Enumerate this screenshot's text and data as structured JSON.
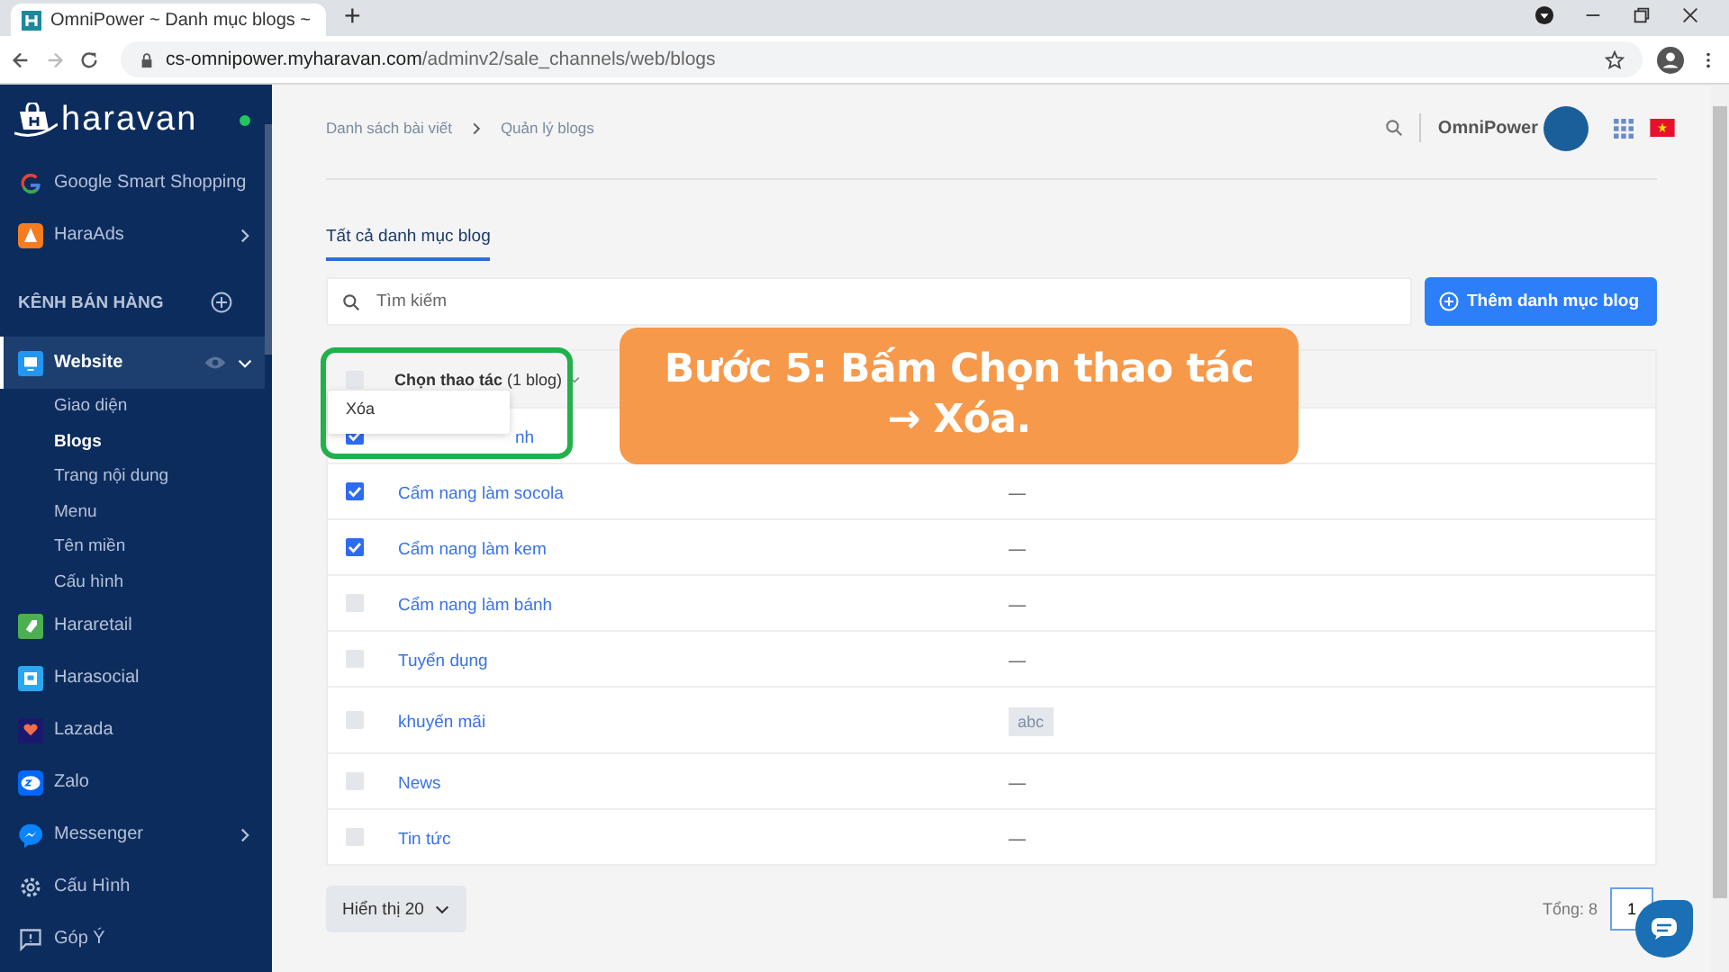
{
  "browser": {
    "tab_title": "OmniPower ~ Danh mục blogs ~",
    "new_tab": "+",
    "url_domain": "cs-omnipower.myharavan.com",
    "url_path": "/adminv2/sale_channels/web/blogs"
  },
  "sidebar": {
    "logo": "haravan",
    "online": true,
    "items": [
      {
        "kind": "google",
        "label": "Google Smart Shopping",
        "selected": false
      },
      {
        "kind": "haraads",
        "label": "HaraAds",
        "expanded": false,
        "selected": false
      },
      {
        "kind": "section",
        "label": "KÊNH BÁN HÀNG"
      },
      {
        "kind": "website",
        "label": "Website",
        "expanded": true,
        "eye": true,
        "selected": true
      },
      {
        "kind": "sub",
        "label": "Giao diện",
        "selected": false
      },
      {
        "kind": "sub",
        "label": "Blogs",
        "selected": true
      },
      {
        "kind": "sub",
        "label": "Trang nội dung",
        "selected": false
      },
      {
        "kind": "sub",
        "label": "Menu",
        "selected": false
      },
      {
        "kind": "sub",
        "label": "Tên miền",
        "selected": false
      },
      {
        "kind": "sub",
        "label": "Cấu hình",
        "selected": false
      },
      {
        "kind": "hararetail",
        "label": "Hararetail",
        "selected": false
      },
      {
        "kind": "harasocial",
        "label": "Harasocial",
        "selected": false
      },
      {
        "kind": "lazada",
        "label": "Lazada",
        "selected": false
      },
      {
        "kind": "zalo",
        "label": "Zalo",
        "selected": false
      },
      {
        "kind": "messenger",
        "label": "Messenger",
        "expanded": false,
        "selected": false
      }
    ],
    "footer": [
      {
        "kind": "gear",
        "label": "Cấu Hình"
      },
      {
        "kind": "feedback",
        "label": "Góp Ý"
      }
    ]
  },
  "breadcrumbs": [
    "Danh sách bài viết",
    "Quản lý blogs"
  ],
  "header": {
    "shop_name": "OmniPower"
  },
  "tabs": [
    {
      "label": "Tất cả danh mục blog",
      "selected": true
    }
  ],
  "search": {
    "placeholder": "Tìm kiếm"
  },
  "add_button": "Thêm danh mục blog",
  "table": {
    "header_checked": false,
    "bulk_label": "**Chọn thao tác** (1 blog)",
    "rows": [
      {
        "title": "nh",
        "checked": true,
        "column_2": {
          "kind": "none"
        }
      },
      {
        "title": "Cẩm nang làm socola",
        "checked": true,
        "column_2": {
          "kind": "text",
          "text": "—"
        }
      },
      {
        "title": "Cẩm nang làm kem",
        "checked": true,
        "column_2": {
          "kind": "text",
          "text": "—"
        }
      },
      {
        "title": "Cẩm nang làm bánh",
        "checked": false,
        "column_2": {
          "kind": "text",
          "text": "—"
        }
      },
      {
        "title": "Tuyển dụng",
        "checked": false,
        "column_2": {
          "kind": "text",
          "text": "—"
        }
      },
      {
        "title": "khuyến mãi",
        "checked": false,
        "column_2": {
          "kind": "tag",
          "text": "abc"
        }
      },
      {
        "title": "News",
        "checked": false,
        "column_2": {
          "kind": "text",
          "text": "—"
        }
      },
      {
        "title": "Tin tức",
        "checked": false,
        "column_2": {
          "kind": "text",
          "text": "—"
        }
      }
    ]
  },
  "dropdown": {
    "items": [
      "Xóa"
    ]
  },
  "callout": {
    "lines": [
      "Bước 5: Bấm Chọn thao tác",
      "→ Xóa."
    ]
  },
  "footer": {
    "page_size": "Hiển thị 20",
    "total": "Tổng: 8",
    "page": "1"
  }
}
